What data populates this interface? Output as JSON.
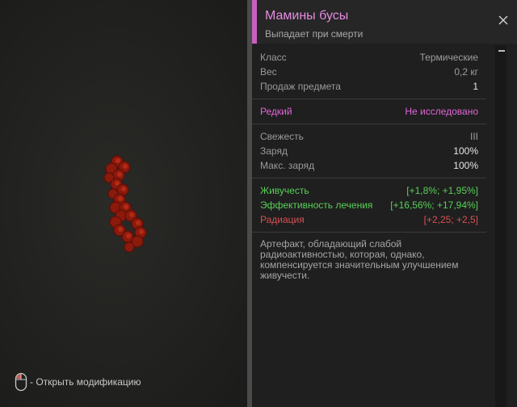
{
  "item": {
    "name": "Мамины бусы",
    "source": "Выпадает при смерти"
  },
  "stats": [
    {
      "label": "Класс",
      "value": "Термические"
    },
    {
      "label": "Вес",
      "value": "0,2 кг"
    },
    {
      "label": "Продаж предмета",
      "value": "1"
    }
  ],
  "rarity": {
    "label": "Редкий",
    "status": "Не исследовано"
  },
  "condition": [
    {
      "label": "Свежесть",
      "value": "III"
    },
    {
      "label": "Заряд",
      "value": "100%"
    },
    {
      "label": "Макс. заряд",
      "value": "100%"
    }
  ],
  "effects": [
    {
      "label": "Живучесть",
      "value": "[+1,8%; +1,95%]",
      "kind": "positive"
    },
    {
      "label": "Эффективность лечения",
      "value": "[+16,56%; +17,94%]",
      "kind": "positive"
    },
    {
      "label": "Радиация",
      "value": "[+2,25; +2,5]",
      "kind": "negative"
    }
  ],
  "description": "Артефакт, обладающий слабой радиоактивностью, которая, однако, компенсируется значительным улучшением живучести.",
  "hint": {
    "icon": "mouse-icon",
    "text": "- Открыть модификацию"
  },
  "colors": {
    "accent": "#e067d6",
    "positive": "#58d058",
    "negative": "#d85050"
  }
}
